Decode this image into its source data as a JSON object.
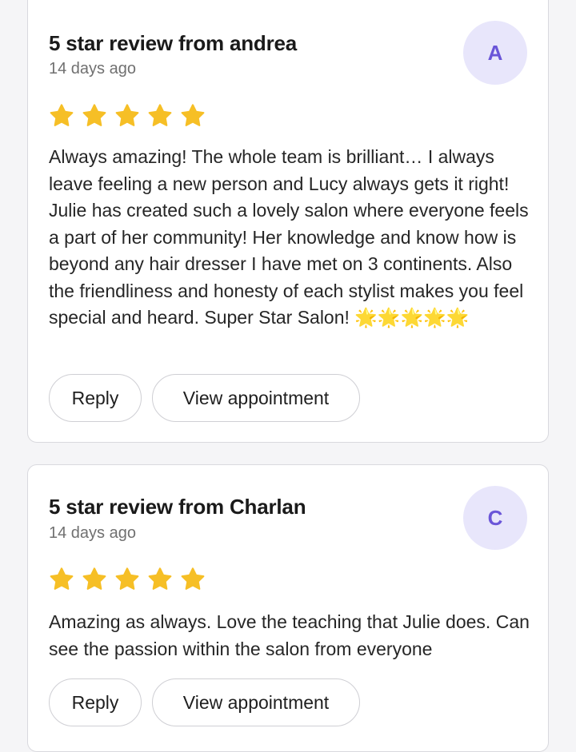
{
  "colors": {
    "star": "#f6bf26",
    "avatar_bg": "#e8e6fb",
    "avatar_text": "#6a55d8"
  },
  "reviews": [
    {
      "title": "5 star review from andrea",
      "date": "14 days ago",
      "avatar_letter": "A",
      "rating": 5,
      "text": "Always amazing! The whole team is brilliant… I always leave feeling a new person and Lucy always gets it right! Julie has created such a lovely salon where everyone feels a part of her community! Her knowledge and know how is beyond any hair dresser I have met on 3 continents. Also the friendliness and honesty of each stylist makes you feel special and heard. Super Star Salon! 🌟🌟🌟🌟🌟",
      "reply_label": "Reply",
      "view_label": "View appointment"
    },
    {
      "title": "5 star review from Charlan",
      "date": "14 days ago",
      "avatar_letter": "C",
      "rating": 5,
      "text": "Amazing as always. Love the teaching that Julie does. Can see the passion within the salon from everyone",
      "reply_label": "Reply",
      "view_label": "View appointment"
    }
  ]
}
